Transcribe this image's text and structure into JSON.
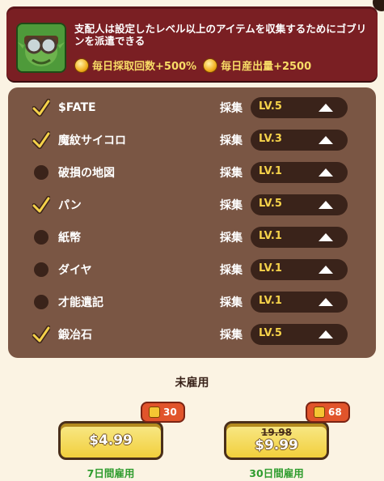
{
  "header": {
    "description": "支配人は設定したレベル以上のアイテムを収集するためにゴブリンを派遣できる",
    "bonuses": [
      {
        "label": "毎日採取回数+500%"
      },
      {
        "label": "毎日産出量+2500"
      }
    ]
  },
  "items": [
    {
      "name": "$FATE",
      "checked": true,
      "action": "採集",
      "level": "LV.5"
    },
    {
      "name": "魔紋サイコロ",
      "checked": true,
      "action": "採集",
      "level": "LV.3"
    },
    {
      "name": "破損の地図",
      "checked": false,
      "action": "採集",
      "level": "LV.1"
    },
    {
      "name": "パン",
      "checked": true,
      "action": "採集",
      "level": "LV.5"
    },
    {
      "name": "紙幣",
      "checked": false,
      "action": "採集",
      "level": "LV.1"
    },
    {
      "name": "ダイヤ",
      "checked": false,
      "action": "採集",
      "level": "LV.1"
    },
    {
      "name": "才能遺記",
      "checked": false,
      "action": "採集",
      "level": "LV.1"
    },
    {
      "name": "鍛冶石",
      "checked": true,
      "action": "採集",
      "level": "LV.5"
    }
  ],
  "status": "未雇用",
  "plans": [
    {
      "price": "$4.99",
      "old_price": "",
      "badge": "30",
      "duration": "7日間雇用"
    },
    {
      "price": "$9.99",
      "old_price": "19.98",
      "badge": "68",
      "duration": "30日間雇用"
    }
  ],
  "colors": {
    "header_bg": "#7a1f23",
    "panel_bg": "#7a5644",
    "level_text": "#f5d24a",
    "bonus_text": "#f8dc66",
    "duration_text": "#2f9c2e"
  }
}
